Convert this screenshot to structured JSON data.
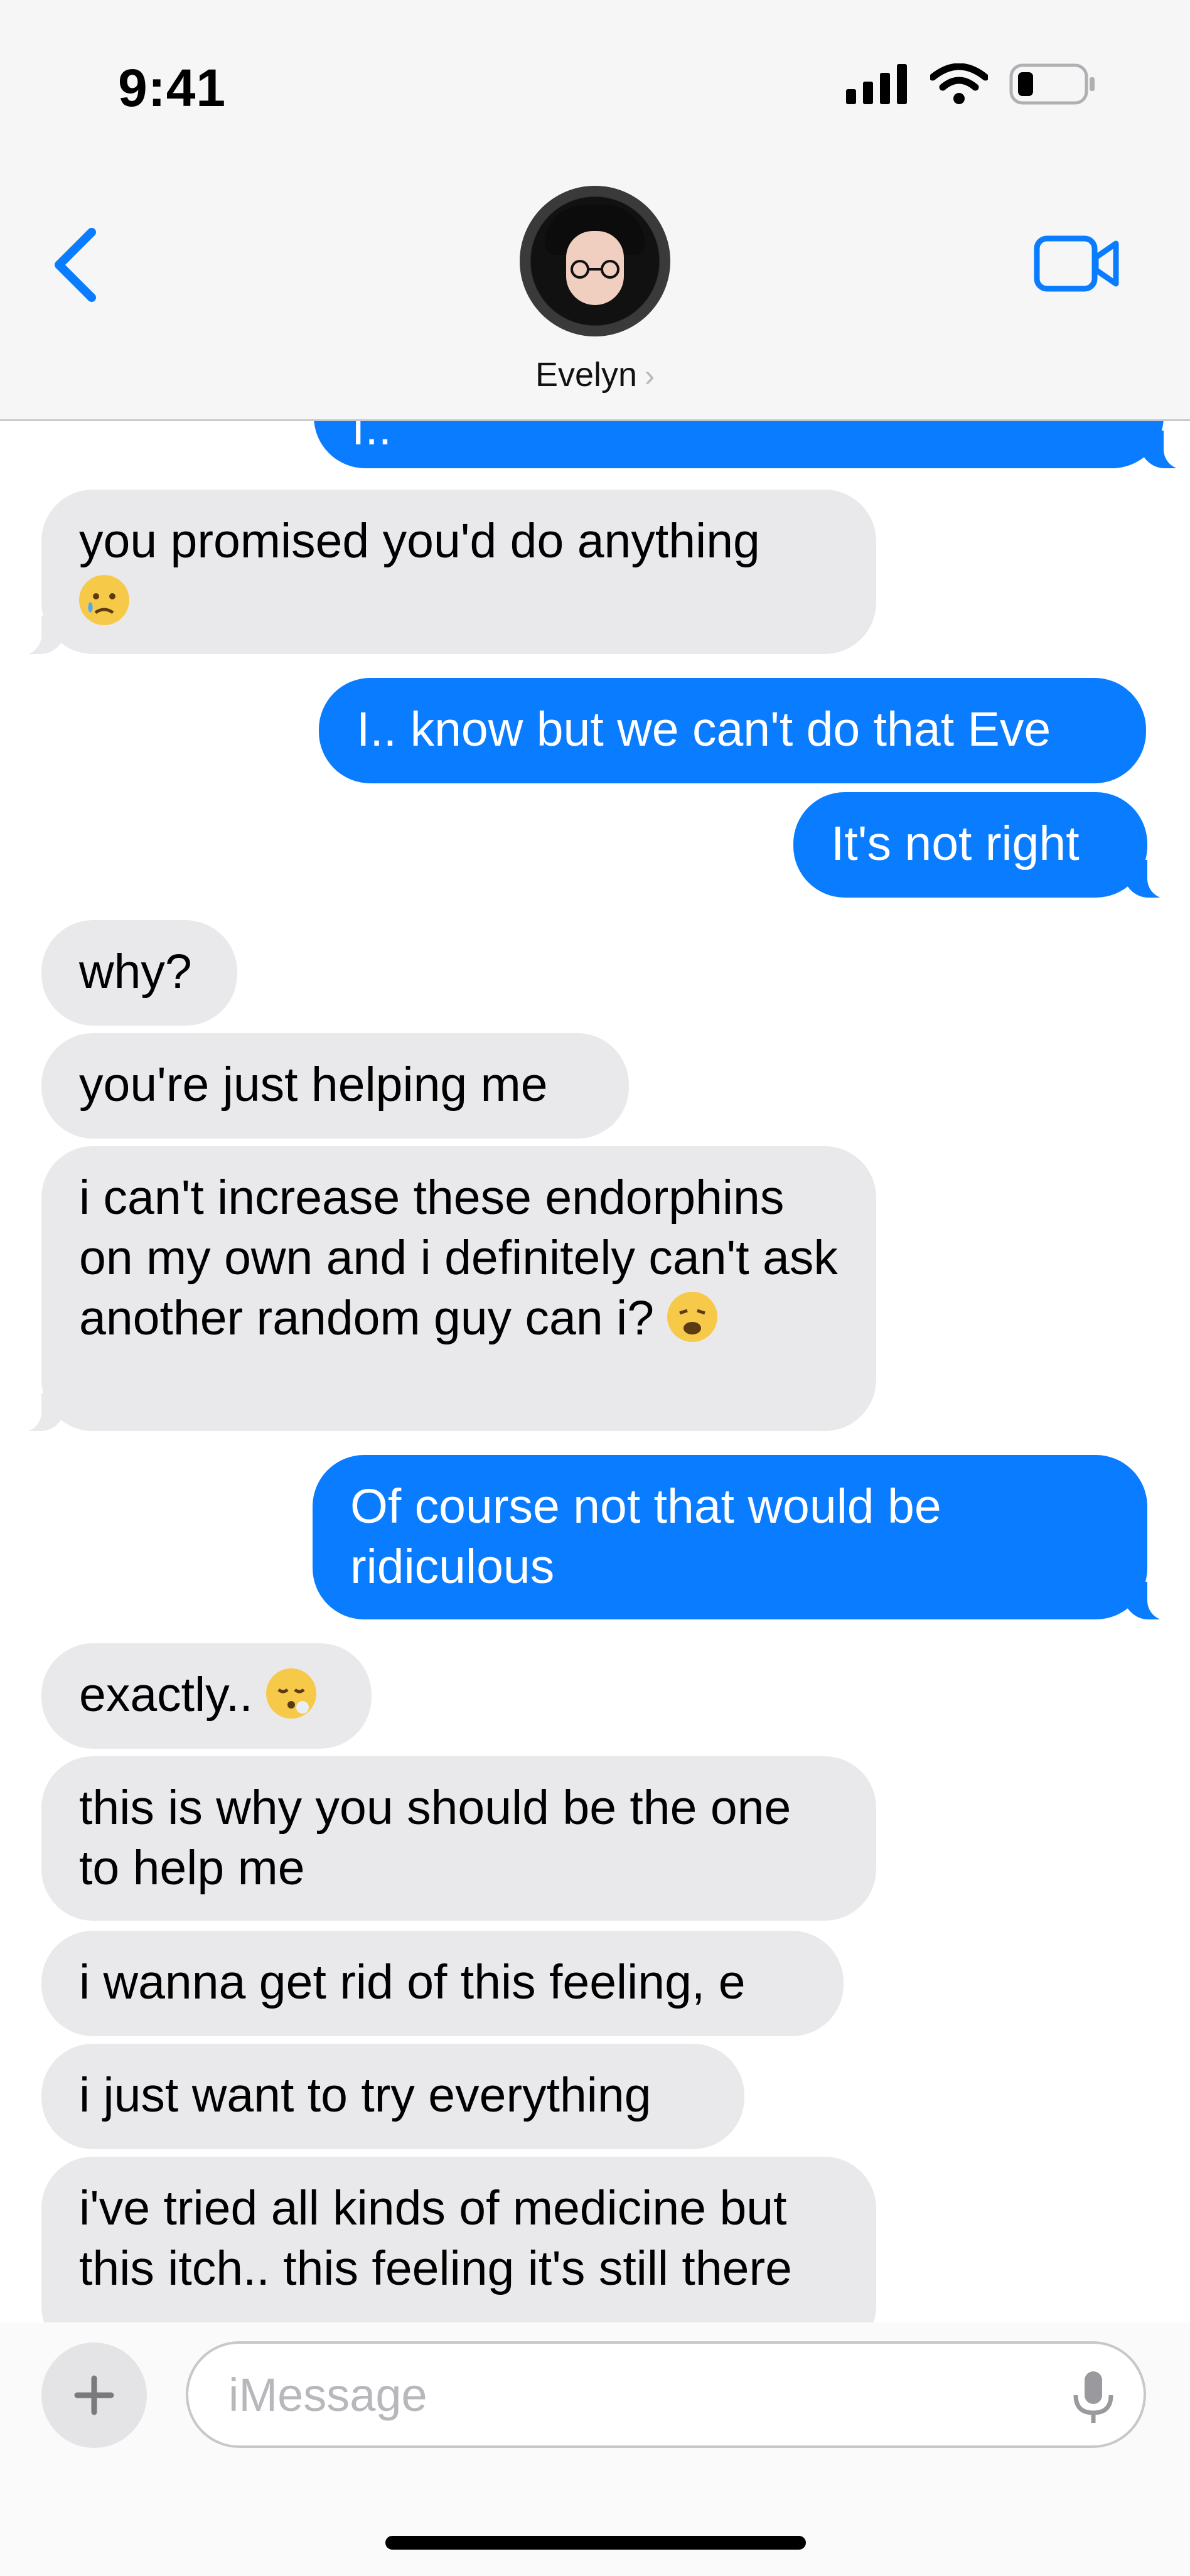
{
  "status_bar": {
    "time": "9:41"
  },
  "header": {
    "contact_name": "Evelyn",
    "chevron": "›"
  },
  "messages": [
    {
      "from": "me",
      "text": "I.."
    },
    {
      "from": "them",
      "text": "you promised you'd do anything",
      "emoji": "crying-face"
    },
    {
      "from": "me",
      "text": "I.. know but we can't do that Eve"
    },
    {
      "from": "me",
      "text": "It's not right"
    },
    {
      "from": "them",
      "text": "why?"
    },
    {
      "from": "them",
      "text": "you're just helping me"
    },
    {
      "from": "them",
      "text": "i can't increase these endorphins on my own and i definitely can't ask another random guy can i?",
      "emoji": "weary-face"
    },
    {
      "from": "me",
      "text": "Of course not that would be ridiculous"
    },
    {
      "from": "them",
      "text": "exactly..",
      "emoji": "face-exhaling"
    },
    {
      "from": "them",
      "text": "this is why you should be the one to help me"
    },
    {
      "from": "them",
      "text": "i wanna get rid of this feeling, e"
    },
    {
      "from": "them",
      "text": "i just want to try everything"
    },
    {
      "from": "them",
      "text": "i've tried all kinds of medicine but this itch.. this feeling it's still there"
    }
  ],
  "composer": {
    "placeholder": "iMessage"
  },
  "colors": {
    "outgoing": "#0a7cff",
    "incoming": "#e9e9eb",
    "accent": "#0a7cff"
  }
}
